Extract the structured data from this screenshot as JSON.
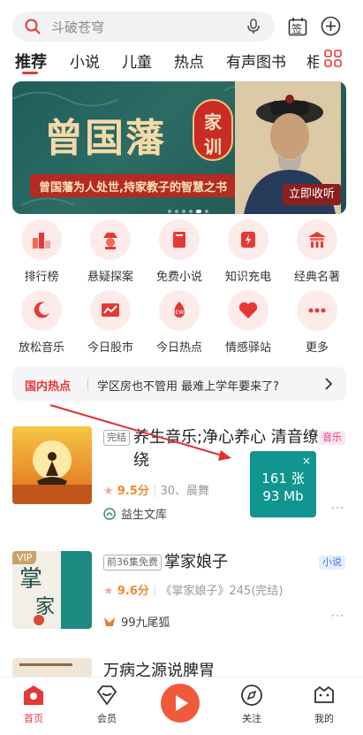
{
  "search": {
    "placeholder": "斗破苍穹"
  },
  "header": {
    "checkin_label": "签"
  },
  "tabs": [
    {
      "label": "推荐"
    },
    {
      "label": "小说"
    },
    {
      "label": "儿童"
    },
    {
      "label": "热点"
    },
    {
      "label": "有声图书"
    },
    {
      "label": "相"
    }
  ],
  "banner": {
    "title": "曾国藩",
    "seal": [
      "家",
      "训"
    ],
    "subtitle": "曾国藩为人处世,持家教子的智慧之书",
    "cta": "立即收听"
  },
  "quick": [
    {
      "label": "排行榜",
      "icon": "ranking-icon"
    },
    {
      "label": "悬疑探案",
      "icon": "detective-icon"
    },
    {
      "label": "免费小说",
      "icon": "book-icon"
    },
    {
      "label": "知识充电",
      "icon": "charge-icon"
    },
    {
      "label": "经典名著",
      "icon": "temple-icon"
    },
    {
      "label": "放松音乐",
      "icon": "moon-icon"
    },
    {
      "label": "今日股市",
      "icon": "stock-icon"
    },
    {
      "label": "今日热点",
      "icon": "news-icon"
    },
    {
      "label": "情感驿站",
      "icon": "heart-icon"
    },
    {
      "label": "更多",
      "icon": "more-icon"
    }
  ],
  "news": {
    "tag": "国内热点",
    "text": "学区房也不管用 最难上学年要来了?"
  },
  "items": [
    {
      "badge": "完结",
      "title": "养生音乐;净心养心 清音缭绕",
      "category": "音乐",
      "score": "9.5分",
      "meta": "30、晨舞",
      "author": "益生文库"
    },
    {
      "cover_tag": "VIP",
      "badge": "前36集免费",
      "title": "掌家娘子",
      "category": "小说",
      "score": "9.6分",
      "meta": "《掌家娘子》245(完结)",
      "author": "99九尾狐"
    },
    {
      "title": "万病之源说脾胃"
    }
  ],
  "popup": {
    "line1": "161 张",
    "line2": "93 Mb",
    "close": "×"
  },
  "nav": [
    {
      "label": "首页"
    },
    {
      "label": "会员"
    },
    {
      "label": "关注"
    },
    {
      "label": "我的"
    }
  ],
  "colors": {
    "accent": "#e53935",
    "popup": "#11958f",
    "banner": "#1e5d5b"
  }
}
